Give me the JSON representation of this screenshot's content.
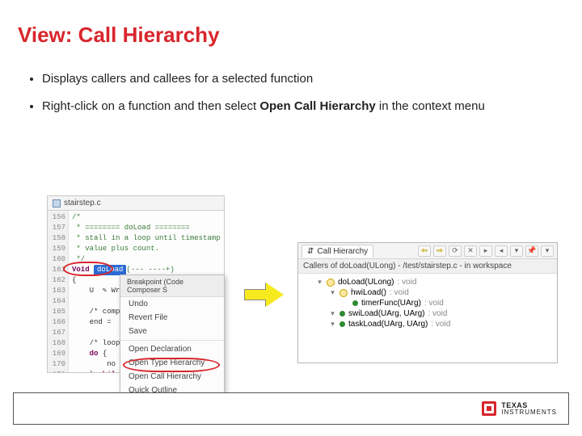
{
  "title": "View: Call Hierarchy",
  "bullets": [
    "Displays callers and callees for a selected function",
    "Right-click on a function and then select <b>Open Call Hierarchy</b> in the context menu"
  ],
  "editor": {
    "filename": "stairstep.c",
    "line_start": 156,
    "lines": [
      "/*",
      " * ======== doLoad ========",
      " * stall in a loop until timestamp ec",
      " * value plus count.",
      " */",
      "Void doLoad(--- ----+)",
      "{",
      "    U  ✎ Writ",
      "",
      "    /* comp",
      "    end =  ",
      "",
      "    /* loop",
      "    do {",
      "        no",
      "    } whil",
      "}",
      ""
    ],
    "selected_fn": "doLoad"
  },
  "context_menu": {
    "header": "Breakpoint (Code Composer S",
    "items": [
      "Undo",
      "Revert File",
      "Save",
      "__sep__",
      "Open Declaration",
      "Open Type Hierarchy",
      "Open Call Hierarchy",
      "Quick Outline"
    ]
  },
  "call_hierarchy": {
    "tab_label": "Call Hierarchy",
    "sub_header": "Callers of doLoad(ULong) - /test/stairstep.c - in workspace",
    "tree": [
      {
        "depth": 0,
        "kind": "fn",
        "label": "doLoad(ULong)",
        "ret": ": void"
      },
      {
        "depth": 1,
        "kind": "fn",
        "label": "hwiLoad()",
        "ret": ": void"
      },
      {
        "depth": 2,
        "kind": "dot",
        "label": "timerFunc(UArg)",
        "ret": ": void"
      },
      {
        "depth": 1,
        "kind": "dot",
        "label": "swiLoad(UArg, UArg)",
        "ret": ": void"
      },
      {
        "depth": 1,
        "kind": "dot",
        "label": "taskLoad(UArg, UArg)",
        "ret": ": void"
      }
    ]
  },
  "footer": {
    "brand_l1": "TEXAS",
    "brand_l2": "INSTRUMENTS"
  }
}
